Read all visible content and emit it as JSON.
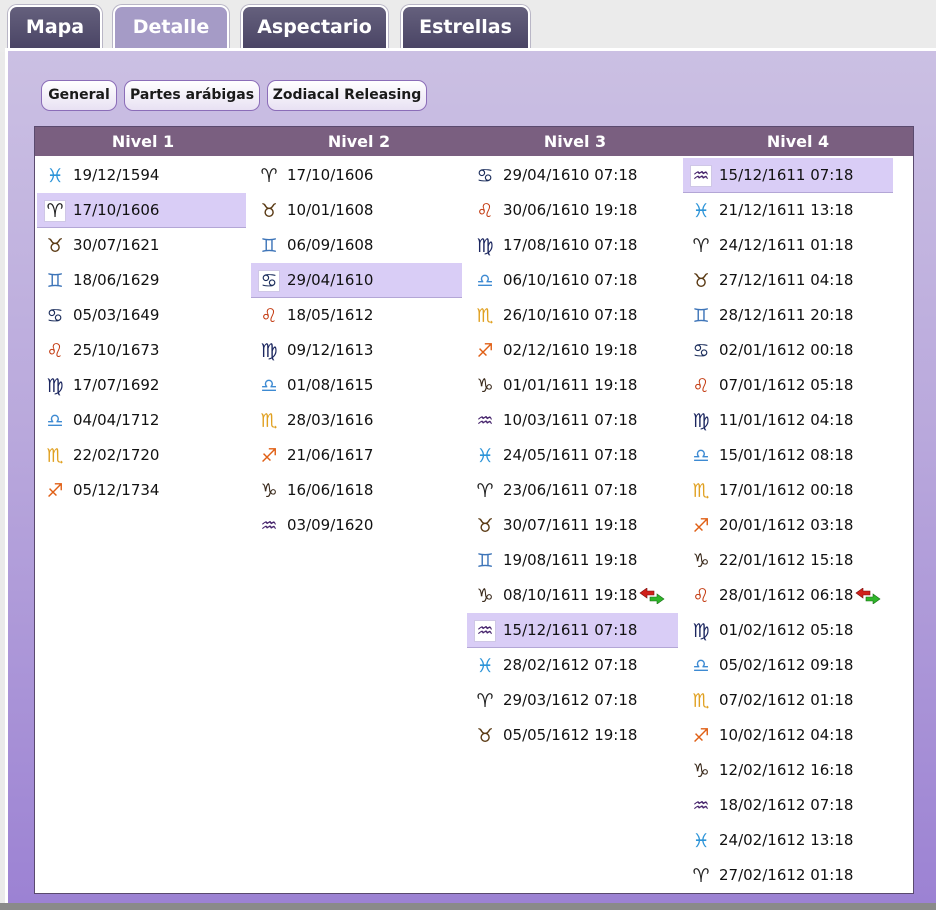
{
  "tabs": [
    {
      "label": "Mapa",
      "active": false
    },
    {
      "label": "Detalle",
      "active": true
    },
    {
      "label": "Aspectario",
      "active": false
    },
    {
      "label": "Estrellas",
      "active": false
    }
  ],
  "subtabs": [
    "General",
    "Partes arábigas",
    "Zodiacal Releasing"
  ],
  "columns": [
    "Nivel 1",
    "Nivel 2",
    "Nivel 3",
    "Nivel 4"
  ],
  "signs": {
    "aries": {
      "glyph": "♈",
      "color": "#222222"
    },
    "taurus": {
      "glyph": "♉",
      "color": "#5a3a14"
    },
    "gemini": {
      "glyph": "♊",
      "color": "#3d74b8"
    },
    "cancer": {
      "glyph": "♋",
      "color": "#1c2e5c"
    },
    "leo": {
      "glyph": "♌",
      "color": "#c33a10"
    },
    "virgo": {
      "glyph": "♍",
      "color": "#1c2760"
    },
    "libra": {
      "glyph": "♎",
      "color": "#3d8ad2"
    },
    "scorpio": {
      "glyph": "♏",
      "color": "#e0a020"
    },
    "sagittarius": {
      "glyph": "♐",
      "color": "#e06016"
    },
    "capricorn": {
      "glyph": "♑",
      "color": "#3a2a1c"
    },
    "aquarius": {
      "glyph": "♒",
      "color": "#46246c"
    },
    "pisces": {
      "glyph": "♓",
      "color": "#2c94d8"
    }
  },
  "level1": [
    {
      "sign": "pisces",
      "date": "19/12/1594"
    },
    {
      "sign": "aries",
      "date": "17/10/1606",
      "selected": true
    },
    {
      "sign": "taurus",
      "date": "30/07/1621"
    },
    {
      "sign": "gemini",
      "date": "18/06/1629"
    },
    {
      "sign": "cancer",
      "date": "05/03/1649"
    },
    {
      "sign": "leo",
      "date": "25/10/1673"
    },
    {
      "sign": "virgo",
      "date": "17/07/1692"
    },
    {
      "sign": "libra",
      "date": "04/04/1712"
    },
    {
      "sign": "scorpio",
      "date": "22/02/1720"
    },
    {
      "sign": "sagittarius",
      "date": "05/12/1734"
    }
  ],
  "level2": [
    {
      "sign": "aries",
      "date": "17/10/1606"
    },
    {
      "sign": "taurus",
      "date": "10/01/1608"
    },
    {
      "sign": "gemini",
      "date": "06/09/1608"
    },
    {
      "sign": "cancer",
      "date": "29/04/1610",
      "selected": true
    },
    {
      "sign": "leo",
      "date": "18/05/1612"
    },
    {
      "sign": "virgo",
      "date": "09/12/1613"
    },
    {
      "sign": "libra",
      "date": "01/08/1615"
    },
    {
      "sign": "scorpio",
      "date": "28/03/1616"
    },
    {
      "sign": "sagittarius",
      "date": "21/06/1617"
    },
    {
      "sign": "capricorn",
      "date": "16/06/1618"
    },
    {
      "sign": "aquarius",
      "date": "03/09/1620"
    }
  ],
  "level3": [
    {
      "sign": "cancer",
      "date": "29/04/1610 07:18"
    },
    {
      "sign": "leo",
      "date": "30/06/1610 19:18"
    },
    {
      "sign": "virgo",
      "date": "17/08/1610 07:18"
    },
    {
      "sign": "libra",
      "date": "06/10/1610 07:18"
    },
    {
      "sign": "scorpio",
      "date": "26/10/1610 07:18"
    },
    {
      "sign": "sagittarius",
      "date": "02/12/1610 19:18"
    },
    {
      "sign": "capricorn",
      "date": "01/01/1611 19:18"
    },
    {
      "sign": "aquarius",
      "date": "10/03/1611 07:18"
    },
    {
      "sign": "pisces",
      "date": "24/05/1611 07:18"
    },
    {
      "sign": "aries",
      "date": "23/06/1611 07:18"
    },
    {
      "sign": "taurus",
      "date": "30/07/1611 19:18"
    },
    {
      "sign": "gemini",
      "date": "19/08/1611 19:18"
    },
    {
      "sign": "capricorn",
      "date": "08/10/1611 19:18",
      "loosing": true
    },
    {
      "sign": "aquarius",
      "date": "15/12/1611 07:18",
      "selected": true
    },
    {
      "sign": "pisces",
      "date": "28/02/1612 07:18"
    },
    {
      "sign": "aries",
      "date": "29/03/1612 07:18"
    },
    {
      "sign": "taurus",
      "date": "05/05/1612 19:18"
    }
  ],
  "level4": [
    {
      "sign": "aquarius",
      "date": "15/12/1611 07:18",
      "selected": true
    },
    {
      "sign": "pisces",
      "date": "21/12/1611 13:18"
    },
    {
      "sign": "aries",
      "date": "24/12/1611 01:18"
    },
    {
      "sign": "taurus",
      "date": "27/12/1611 04:18"
    },
    {
      "sign": "gemini",
      "date": "28/12/1611 20:18"
    },
    {
      "sign": "cancer",
      "date": "02/01/1612 00:18"
    },
    {
      "sign": "leo",
      "date": "07/01/1612 05:18"
    },
    {
      "sign": "virgo",
      "date": "11/01/1612 04:18"
    },
    {
      "sign": "libra",
      "date": "15/01/1612 08:18"
    },
    {
      "sign": "scorpio",
      "date": "17/01/1612 00:18"
    },
    {
      "sign": "sagittarius",
      "date": "20/01/1612 03:18"
    },
    {
      "sign": "capricorn",
      "date": "22/01/1612 15:18"
    },
    {
      "sign": "leo",
      "date": "28/01/1612 06:18",
      "loosing": true
    },
    {
      "sign": "virgo",
      "date": "01/02/1612 05:18"
    },
    {
      "sign": "libra",
      "date": "05/02/1612 09:18"
    },
    {
      "sign": "scorpio",
      "date": "07/02/1612 01:18"
    },
    {
      "sign": "sagittarius",
      "date": "10/02/1612 04:18"
    },
    {
      "sign": "capricorn",
      "date": "12/02/1612 16:18"
    },
    {
      "sign": "aquarius",
      "date": "18/02/1612 07:18"
    },
    {
      "sign": "pisces",
      "date": "24/02/1612 13:18"
    },
    {
      "sign": "aries",
      "date": "27/02/1612 01:18"
    }
  ]
}
